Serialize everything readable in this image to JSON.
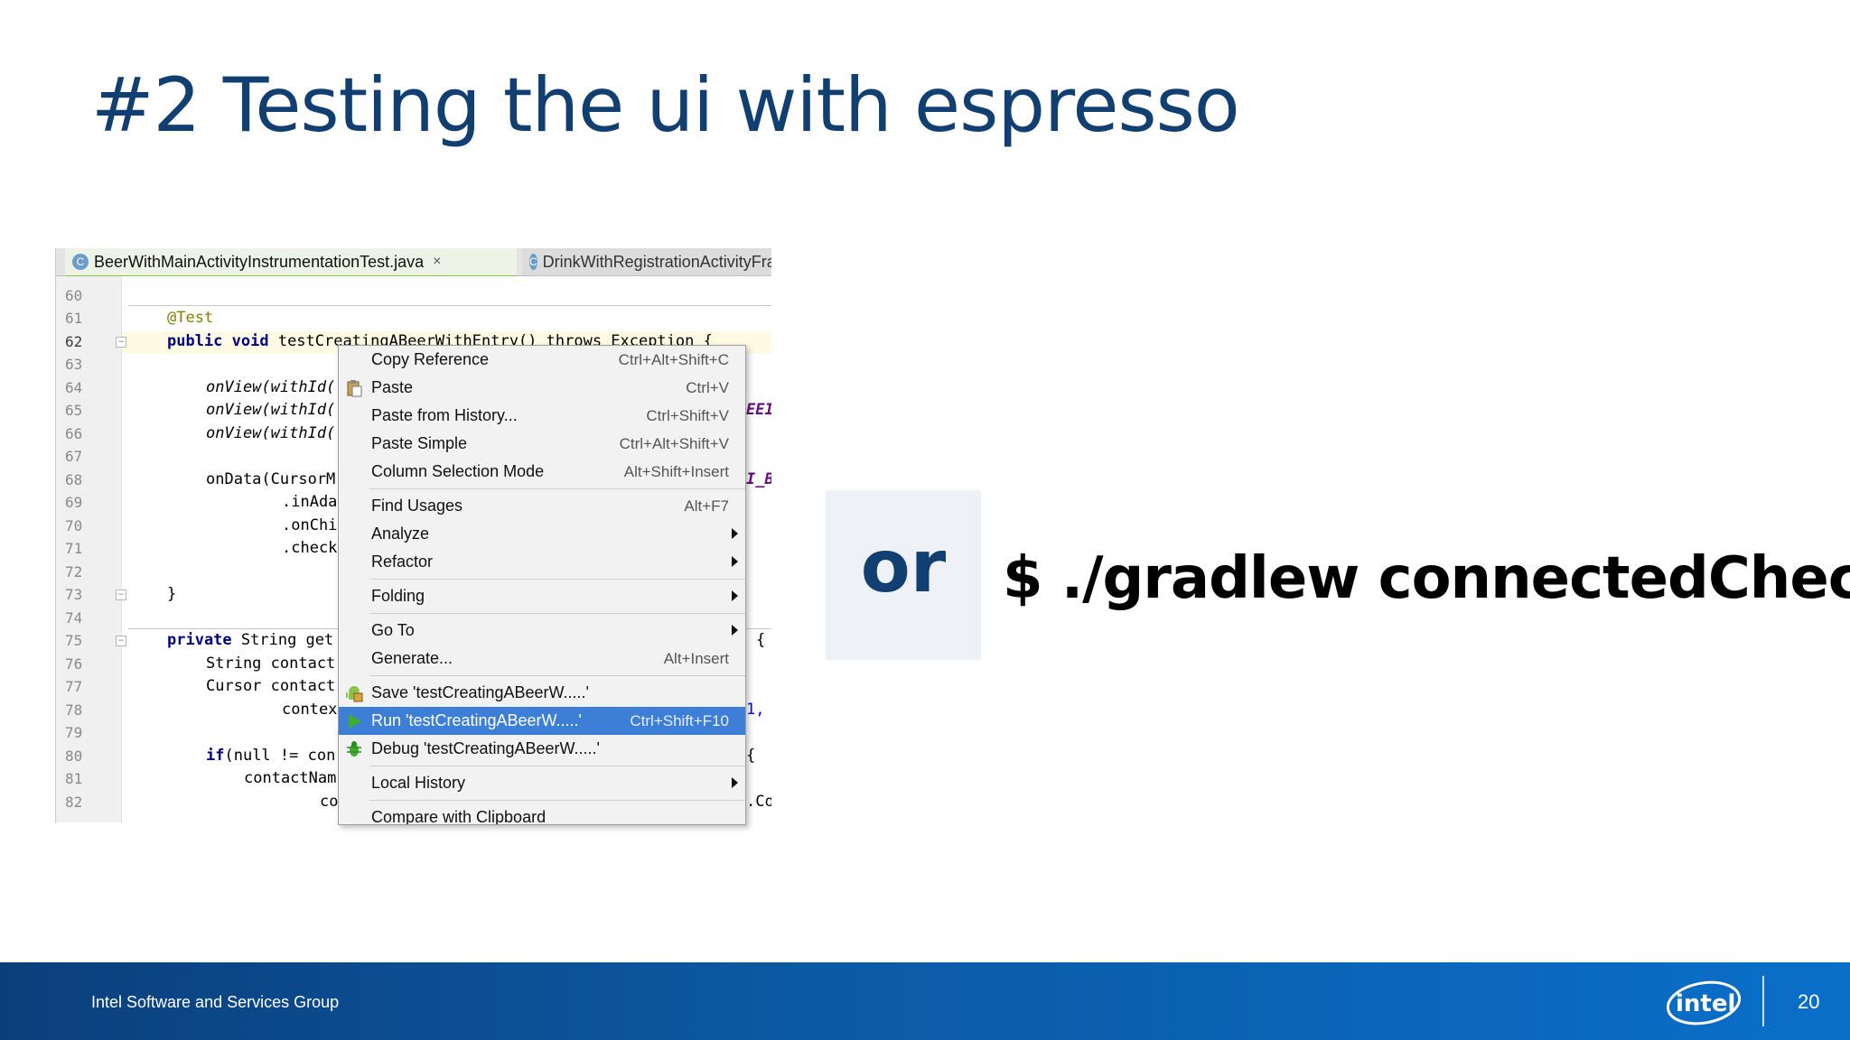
{
  "slide": {
    "title": "#2 Testing the ui with espresso",
    "or_label": "or",
    "command": "$ ./gradlew connectedCheck"
  },
  "footer": {
    "org": "Intel Software and Services Group",
    "page": "20",
    "logo_text": "intel"
  },
  "ide": {
    "tabs": [
      {
        "label": "BeerWithMainActivityInstrumentationTest.java",
        "close": "×",
        "icon": "C"
      },
      {
        "label": "DrinkWithRegistrationActivityFragmen",
        "icon": "C"
      }
    ],
    "line_numbers": [
      "60",
      "61",
      "62",
      "63",
      "64",
      "65",
      "66",
      "67",
      "68",
      "69",
      "70",
      "71",
      "72",
      "73",
      "74",
      "75",
      "76",
      "77",
      "78",
      "79",
      "80",
      "81",
      "82"
    ],
    "code": {
      "l61": "@Test",
      "l62_kw": "public void",
      "l62_rest": " testCreatingABeerWithEntry() throws Exception {",
      "l64": "onView(withId(",
      "l65": "onView(withId(",
      "l66": "onView(withId(",
      "l68": "onData(CursorM",
      "l69": ".inAda",
      "l70": ".onChi",
      "l71": ".check",
      "l73": "}",
      "l75_kw": "private",
      "l75_rest": " String get",
      "l76": "String contact",
      "l77": "Cursor contact",
      "l78": "contex",
      "l80_kw": "if",
      "l80_rest": "(null != con",
      "l81": "contactNam",
      "l82": "co",
      "r65": "EEI",
      "r68": "I_BI",
      "r75": "{",
      "r78": "1,",
      "r80": "{",
      "r82": ".Co"
    }
  },
  "context_menu": {
    "items": [
      {
        "label": "Copy Reference",
        "shortcut": "Ctrl+Alt+Shift+C"
      },
      {
        "label": "Paste",
        "shortcut": "Ctrl+V",
        "icon": "paste-icon"
      },
      {
        "label": "Paste from History...",
        "shortcut": "Ctrl+Shift+V"
      },
      {
        "label": "Paste Simple",
        "shortcut": "Ctrl+Alt+Shift+V"
      },
      {
        "label": "Column Selection Mode",
        "shortcut": "Alt+Shift+Insert"
      },
      {
        "label": "Find Usages",
        "shortcut": "Alt+F7"
      },
      {
        "label": "Analyze",
        "submenu": true
      },
      {
        "label": "Refactor",
        "submenu": true
      },
      {
        "label": "Folding",
        "submenu": true
      },
      {
        "label": "Go To",
        "submenu": true
      },
      {
        "label": "Generate...",
        "shortcut": "Alt+Insert"
      },
      {
        "label": "Save 'testCreatingABeerW.....'",
        "icon": "android-icon"
      },
      {
        "label": "Run 'testCreatingABeerW.....'",
        "shortcut": "Ctrl+Shift+F10",
        "icon": "run-icon",
        "selected": true
      },
      {
        "label": "Debug 'testCreatingABeerW.....'",
        "icon": "debug-icon"
      },
      {
        "label": "Local History",
        "submenu": true
      },
      {
        "label": "Compare with Clipboard"
      }
    ]
  },
  "colors": {
    "title": "#123f72",
    "menu_selection": "#3d7fd6",
    "footer_start": "#0b3f7c",
    "footer_end": "#0a6fc9"
  }
}
